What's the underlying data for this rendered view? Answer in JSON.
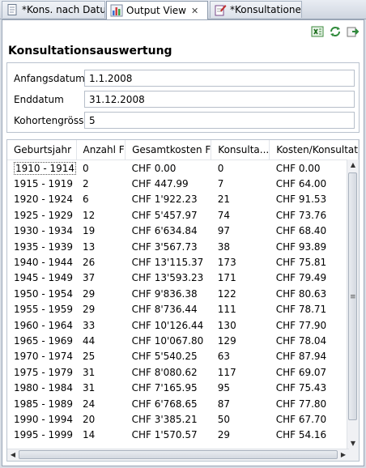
{
  "tabs": [
    {
      "label": "*Kons. nach Datum",
      "icon": "document-icon",
      "active": false
    },
    {
      "label": "Output View",
      "icon": "bar-chart-icon",
      "active": true
    },
    {
      "label": "*Konsultationen",
      "icon": "edit-document-icon",
      "active": false
    }
  ],
  "toolbar": {
    "icons": [
      "export-excel-icon",
      "refresh-icon",
      "forward-icon"
    ]
  },
  "title": "Konsultationsauswertung",
  "form": {
    "start_label": "Anfangsdatum",
    "start_value": "1.1.2008",
    "end_label": "Enddatum",
    "end_value": "31.12.2008",
    "cohort_label": "Kohortengrösse",
    "cohort_value": "5"
  },
  "table": {
    "columns": [
      "Geburtsjahr",
      "Anzahl F",
      "Gesamtkosten F",
      "Konsulta...",
      "Kosten/Konsultat"
    ],
    "rows": [
      [
        "1910 - 1914",
        "0",
        "CHF 0.00",
        "0",
        "CHF 0.00"
      ],
      [
        "1915 - 1919",
        "2",
        "CHF 447.99",
        "7",
        "CHF 64.00"
      ],
      [
        "1920 - 1924",
        "6",
        "CHF 1'922.23",
        "21",
        "CHF 91.53"
      ],
      [
        "1925 - 1929",
        "12",
        "CHF 5'457.97",
        "74",
        "CHF 73.76"
      ],
      [
        "1930 - 1934",
        "19",
        "CHF 6'634.84",
        "97",
        "CHF 68.40"
      ],
      [
        "1935 - 1939",
        "13",
        "CHF 3'567.73",
        "38",
        "CHF 93.89"
      ],
      [
        "1940 - 1944",
        "26",
        "CHF 13'115.37",
        "173",
        "CHF 75.81"
      ],
      [
        "1945 - 1949",
        "37",
        "CHF 13'593.23",
        "171",
        "CHF 79.49"
      ],
      [
        "1950 - 1954",
        "29",
        "CHF 9'836.38",
        "122",
        "CHF 80.63"
      ],
      [
        "1955 - 1959",
        "29",
        "CHF 8'736.44",
        "111",
        "CHF 78.71"
      ],
      [
        "1960 - 1964",
        "33",
        "CHF 10'126.44",
        "130",
        "CHF 77.90"
      ],
      [
        "1965 - 1969",
        "44",
        "CHF 10'067.80",
        "129",
        "CHF 78.04"
      ],
      [
        "1970 - 1974",
        "25",
        "CHF 5'540.25",
        "63",
        "CHF 87.94"
      ],
      [
        "1975 - 1979",
        "31",
        "CHF 8'080.62",
        "117",
        "CHF 69.07"
      ],
      [
        "1980 - 1984",
        "31",
        "CHF 7'165.95",
        "95",
        "CHF 75.43"
      ],
      [
        "1985 - 1989",
        "24",
        "CHF 6'768.65",
        "87",
        "CHF 77.80"
      ],
      [
        "1990 - 1994",
        "20",
        "CHF 3'385.21",
        "50",
        "CHF 67.70"
      ],
      [
        "1995 - 1999",
        "14",
        "CHF 1'570.57",
        "29",
        "CHF 54.16"
      ]
    ]
  }
}
